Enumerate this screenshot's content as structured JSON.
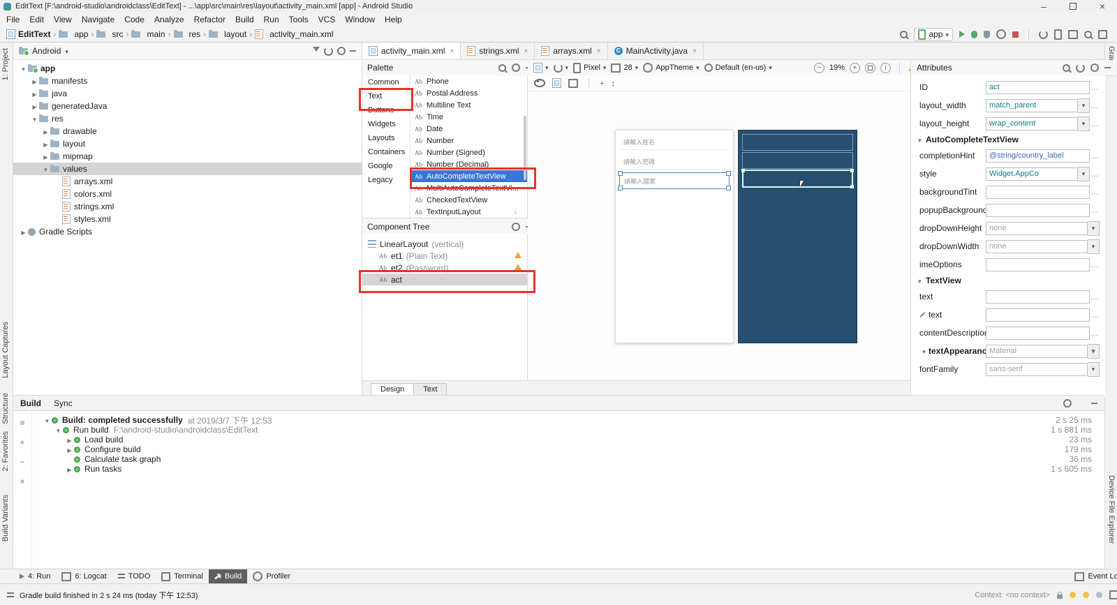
{
  "titlebar": {
    "title": "EditText [F:\\android-studio\\androidclass\\EditText] - ...\\app\\src\\main\\res\\layout\\activity_main.xml [app] - Android Studio"
  },
  "menubar": {
    "items": [
      "File",
      "Edit",
      "View",
      "Navigate",
      "Code",
      "Analyze",
      "Refactor",
      "Build",
      "Run",
      "Tools",
      "VCS",
      "Window",
      "Help"
    ]
  },
  "navbar": {
    "breadcrumbs": [
      "EditText",
      "app",
      "src",
      "main",
      "res",
      "layout",
      "activity_main.xml"
    ],
    "run_config": "app"
  },
  "stripes": {
    "left": [
      "1: Project",
      "Layout Captures",
      "Structure",
      "2: Favorites",
      "Build Variants"
    ],
    "right": [
      "Gradle",
      "Device File Explorer"
    ]
  },
  "project": {
    "selector": "Android",
    "items": [
      {
        "label": "app"
      },
      {
        "label": "manifests"
      },
      {
        "label": "java"
      },
      {
        "label": "generatedJava"
      },
      {
        "label": "res"
      },
      {
        "label": "drawable"
      },
      {
        "label": "layout"
      },
      {
        "label": "mipmap"
      },
      {
        "label": "values"
      },
      {
        "label": "arrays.xml"
      },
      {
        "label": "colors.xml"
      },
      {
        "label": "strings.xml"
      },
      {
        "label": "styles.xml"
      },
      {
        "label": "Gradle Scripts"
      }
    ]
  },
  "editor": {
    "tabs": [
      "activity_main.xml",
      "strings.xml",
      "arrays.xml",
      "MainActivity.java"
    ],
    "bottom_tabs": [
      "Design",
      "Text"
    ]
  },
  "design_toolbar": {
    "device": "Pixel",
    "api": "28",
    "theme": "AppTheme",
    "locale": "Default (en-us)",
    "zoom": "19%"
  },
  "palette": {
    "title": "Palette",
    "categories": [
      "Common",
      "Text",
      "Buttons",
      "Widgets",
      "Layouts",
      "Containers",
      "Google",
      "Legacy"
    ],
    "items": [
      "Phone",
      "Postal Address",
      "Multiline Text",
      "Time",
      "Date",
      "Number",
      "Number (Signed)",
      "Number (Decimal)",
      "AutoCompleteTextView",
      "MultiAutoCompleteTextVi...",
      "CheckedTextView",
      "TextInputLayout"
    ]
  },
  "component_tree": {
    "title": "Component Tree",
    "items": [
      {
        "label": "LinearLayout",
        "suffix": "(vertical)"
      },
      {
        "label": "et1",
        "suffix": "(Plain Text)"
      },
      {
        "label": "et2",
        "suffix": "(Password)"
      },
      {
        "label": "act",
        "suffix": ""
      }
    ]
  },
  "canvas": {
    "hints": [
      "請輸入姓名",
      "請輸入密碼",
      "請輸入國家"
    ]
  },
  "attributes": {
    "title": "Attributes",
    "id": {
      "label": "ID",
      "value": "act"
    },
    "layout_width": {
      "label": "layout_width",
      "value": "match_parent"
    },
    "layout_height": {
      "label": "layout_height",
      "value": "wrap_content"
    },
    "section_autocomplete": "AutoCompleteTextView",
    "completionHint": {
      "label": "completionHint",
      "value": "@string/country_label"
    },
    "style": {
      "label": "style",
      "value": "Widget.AppCo"
    },
    "backgroundTint": {
      "label": "backgroundTint",
      "value": ""
    },
    "popupBackground": {
      "label": "popupBackground",
      "value": ""
    },
    "dropDownHeight": {
      "label": "dropDownHeight",
      "value": "none"
    },
    "dropDownWidth": {
      "label": "dropDownWidth",
      "value": "none"
    },
    "imeOptions": {
      "label": "imeOptions",
      "value": ""
    },
    "section_textview": "TextView",
    "text": {
      "label": "text",
      "value": ""
    },
    "text_tools": {
      "label": "text",
      "value": ""
    },
    "contentDescription": {
      "label": "contentDescription",
      "value": ""
    },
    "section_textappearance": "textAppearance",
    "textAppearance_value": "Material",
    "fontFamily": {
      "label": "fontFamily",
      "value": "sans-serif"
    }
  },
  "build": {
    "tabs": [
      "Build",
      "Sync"
    ],
    "rows": [
      {
        "label": "Build: completed successfully",
        "detail": "at 2019/3/7 下午 12:53",
        "time": "2 s 25 ms"
      },
      {
        "label": "Run build",
        "detail": "F:\\android-studio\\androidclass\\EditText",
        "time": "1 s 881 ms"
      },
      {
        "label": "Load build",
        "detail": "",
        "time": "23 ms"
      },
      {
        "label": "Configure build",
        "detail": "",
        "time": "179 ms"
      },
      {
        "label": "Calculate task graph",
        "detail": "",
        "time": "36 ms"
      },
      {
        "label": "Run tasks",
        "detail": "",
        "time": "1 s 605 ms"
      }
    ]
  },
  "bottom_bar": {
    "items": [
      "4: Run",
      "6: Logcat",
      "TODO",
      "Terminal",
      "Build",
      "Profiler"
    ],
    "event_log": "Event Log"
  },
  "statusbar": {
    "message": "Gradle build finished in 2 s 24 ms (today 下午 12:53)",
    "context": "Context: <no context>"
  }
}
